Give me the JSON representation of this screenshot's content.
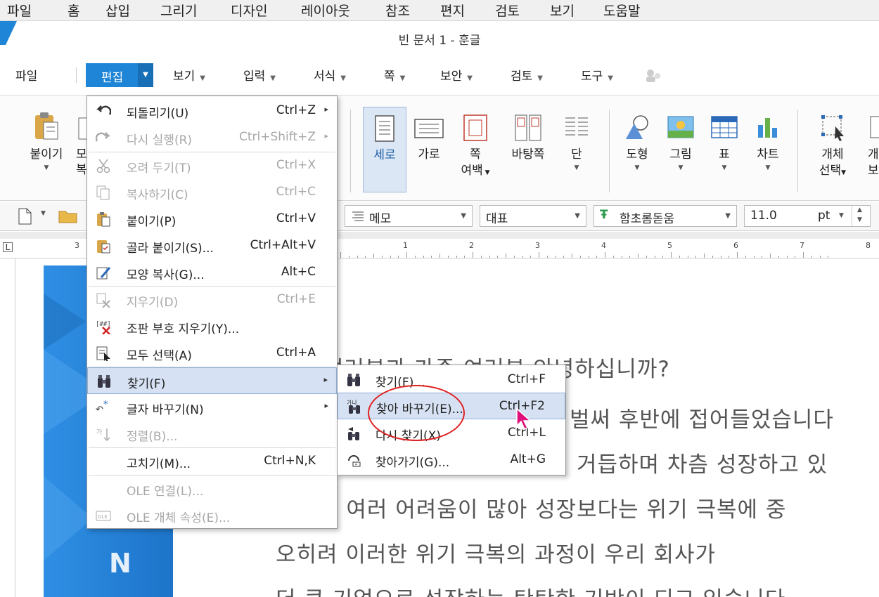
{
  "outer_menubar": [
    "파일",
    "홈",
    "삽입",
    "그리기",
    "디자인",
    "레이아웃",
    "참조",
    "편지",
    "검토",
    "보기",
    "도움말"
  ],
  "window": {
    "title": "빈 문서 1 - 훈글"
  },
  "main_menu": {
    "file": "파일",
    "edit": "편집",
    "items": [
      "보기",
      "입력",
      "서식",
      "쪽",
      "보안",
      "검토",
      "도구"
    ]
  },
  "ribbon": {
    "paste": "붙이기",
    "partial_left_1": "모",
    "partial_left_2": "복",
    "portrait": "세로",
    "landscape": "가로",
    "page_margin_1": "쪽",
    "page_margin_2": "여백",
    "page_border": "바탕쪽",
    "columns": "단",
    "shape": "도형",
    "picture": "그림",
    "table": "표",
    "chart": "차트",
    "object_select_1": "개체",
    "object_select_2": "선택",
    "partial_right_1": "개",
    "partial_right_2": "보"
  },
  "format_bar": {
    "style": "메모",
    "para": "대표",
    "font": "함초롬돋움",
    "size": "11.0",
    "unit": "pt"
  },
  "ruler": {
    "left_numbers": [
      "3"
    ],
    "numbers": [
      "1",
      "2",
      "3",
      "4",
      "5",
      "6",
      "7",
      "8",
      "9"
    ]
  },
  "document": {
    "lines": [
      "여러분과 가족 여러분 안녕하십니까?",
      "벌써 후반에 접어들었습니다",
      "거듭하며 차츰 성장하고 있",
      "는 여러 어려움이 많아 성장보다는 위기 극복에 중",
      "오히려 이러한 위기 극복의 과정이 우리 회사가",
      "더 큰 기업으로 성장하는 탄탄한 기반이 되고 있습니다"
    ]
  },
  "edit_menu": {
    "items": [
      {
        "label": "되돌리기(U)",
        "shortcut": "Ctrl+Z",
        "icon": "undo-icon",
        "submenu": true,
        "disabled": false
      },
      {
        "label": "다시 실행(R)",
        "shortcut": "Ctrl+Shift+Z",
        "icon": "redo-icon",
        "submenu": true,
        "disabled": true
      },
      {
        "label": "오려 두기(T)",
        "shortcut": "Ctrl+X",
        "icon": "cut-icon",
        "disabled": true
      },
      {
        "label": "복사하기(C)",
        "shortcut": "Ctrl+C",
        "icon": "copy-icon",
        "disabled": true
      },
      {
        "label": "붙이기(P)",
        "shortcut": "Ctrl+V",
        "icon": "paste-icon",
        "disabled": false
      },
      {
        "label": "골라 붙이기(S)...",
        "shortcut": "Ctrl+Alt+V",
        "icon": "paste-special-icon",
        "disabled": false
      },
      {
        "label": "모양 복사(G)...",
        "shortcut": "Alt+C",
        "icon": "format-painter-icon",
        "disabled": false
      },
      {
        "label": "지우기(D)",
        "shortcut": "Ctrl+E",
        "icon": "erase-icon",
        "disabled": true
      },
      {
        "label": "조판 부호 지우기(Y)...",
        "shortcut": "",
        "icon": "delete-marks-icon",
        "disabled": false
      },
      {
        "label": "모두 선택(A)",
        "shortcut": "Ctrl+A",
        "icon": "select-all-icon",
        "disabled": false
      },
      {
        "label": "찾기(F)",
        "shortcut": "",
        "icon": "binoculars-icon",
        "submenu": true,
        "disabled": false,
        "highlighted": true
      },
      {
        "label": "글자 바꾸기(N)",
        "shortcut": "",
        "icon": "change-case-icon",
        "submenu": true,
        "disabled": false
      },
      {
        "label": "정렬(B)...",
        "shortcut": "",
        "icon": "sort-icon",
        "disabled": true
      },
      {
        "label": "고치기(M)...",
        "shortcut": "Ctrl+N,K",
        "icon": "",
        "disabled": false
      },
      {
        "label": "OLE 연결(L)...",
        "shortcut": "",
        "icon": "",
        "disabled": true
      },
      {
        "label": "OLE 개체 속성(E)...",
        "shortcut": "",
        "icon": "ole-icon",
        "disabled": true
      }
    ]
  },
  "find_submenu": {
    "items": [
      {
        "label": "찾기(F)...",
        "shortcut": "Ctrl+F"
      },
      {
        "label": "찾아 바꾸기(E)...",
        "shortcut": "Ctrl+F2"
      },
      {
        "label": "다시 찾기(X)",
        "shortcut": "Ctrl+L"
      },
      {
        "label": "찾아가기(G)...",
        "shortcut": "Alt+G"
      }
    ]
  },
  "colors": {
    "accent": "#1f85d6",
    "highlight": "#d6e2f3",
    "annotation": "#e02020",
    "cursor": "#e0107a"
  }
}
